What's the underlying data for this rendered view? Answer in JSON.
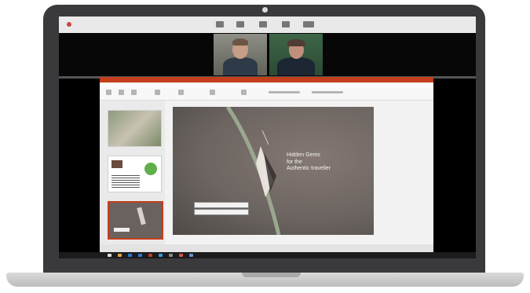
{
  "zoom": {
    "window_title": "",
    "participants": [
      {
        "name": ""
      },
      {
        "name": ""
      }
    ]
  },
  "powerpoint": {
    "title": "",
    "tabs": [
      "",
      "",
      "",
      "",
      "",
      "",
      "",
      ""
    ],
    "slide": {
      "title_lines": [
        "Hidden Gems",
        "for the",
        "Authentic traveller"
      ],
      "box_labels": [
        "",
        ""
      ]
    },
    "thumbnails": [
      {
        "number": ""
      },
      {
        "number": ""
      },
      {
        "number": ""
      }
    ],
    "notes_placeholder": ""
  },
  "taskbar": {
    "clock": ""
  },
  "colors": {
    "ppt_accent": "#c43e1c",
    "laptop_frame": "#3a3a3c"
  }
}
